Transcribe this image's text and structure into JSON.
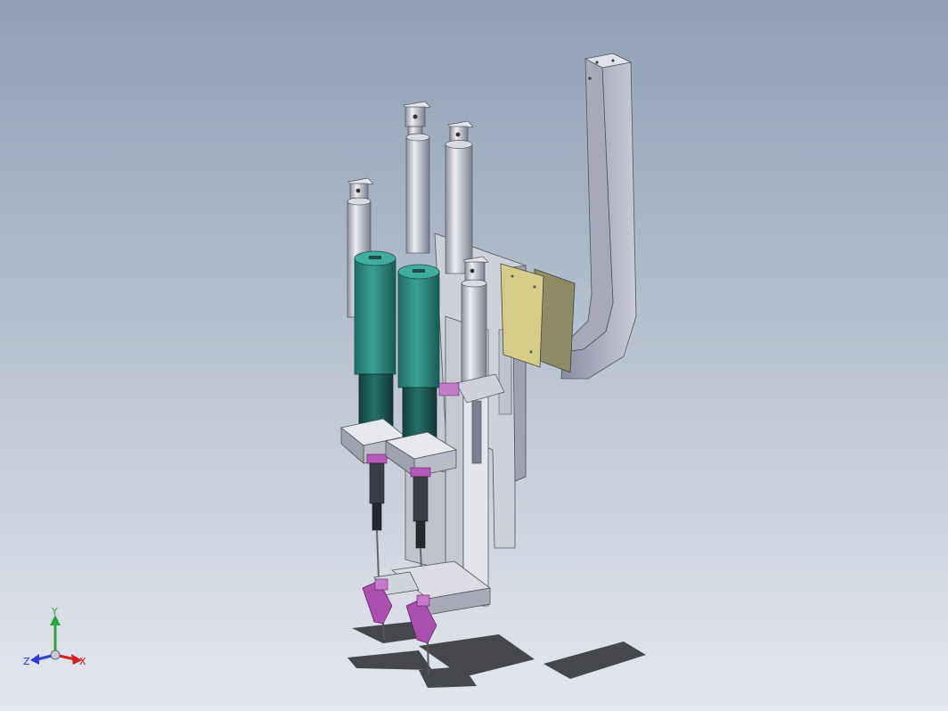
{
  "viewport": {
    "background_top": "#8f9fb2",
    "background_bottom": "#e4e7ee"
  },
  "colors": {
    "steel_light": "#d4d6de",
    "steel_mid": "#a9acb8",
    "steel_dark": "#6f7282",
    "teal": "#2e8a80",
    "teal_dark": "#1e5f58",
    "yellow_plate": "#cfc783",
    "magenta": "#b35ab8",
    "shadow": "#3c3e42"
  },
  "triad": {
    "x_label": "X",
    "y_label": "Y",
    "z_label": "Z",
    "x_color": "#d61f1f",
    "y_color": "#27a83a",
    "z_color": "#2b3fd4"
  }
}
